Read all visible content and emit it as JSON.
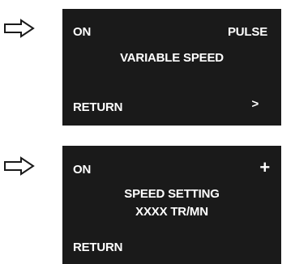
{
  "screens": [
    {
      "left_label": "ON",
      "right_label": "PULSE",
      "title": "VARIABLE SPEED",
      "bottom_left": "RETURN",
      "nav_symbol": ">"
    },
    {
      "left_label": "ON",
      "nav_symbol": "+",
      "title": "SPEED SETTING",
      "value": "XXXX TR/MN",
      "bottom_left": "RETURN"
    }
  ],
  "icons": {
    "indicator": "hollow-right-arrow-icon"
  },
  "colors": {
    "screen_bg": "#1a1a1a",
    "screen_text": "#ffffff"
  }
}
